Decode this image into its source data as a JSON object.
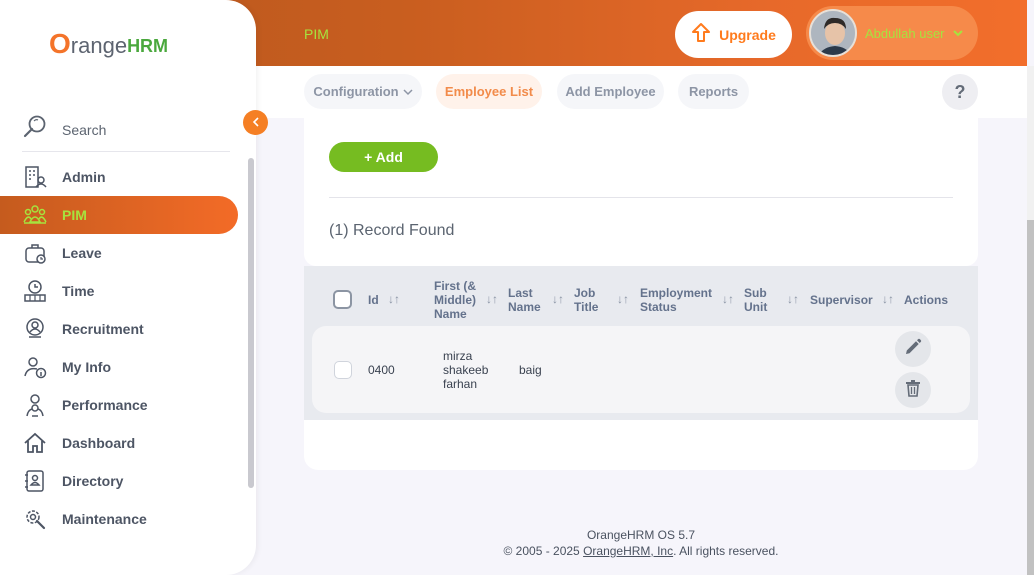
{
  "header": {
    "module_title": "PIM",
    "upgrade_label": "Upgrade",
    "user_name": "Abdullah user"
  },
  "subnav": {
    "items": [
      {
        "label": "Configuration"
      },
      {
        "label": "Employee List"
      },
      {
        "label": "Add Employee"
      },
      {
        "label": "Reports"
      }
    ],
    "active": "Employee List",
    "help_label": "?"
  },
  "sidebar": {
    "logo": {
      "o": "O",
      "range": "range",
      "hrm": "HRM"
    },
    "search_label": "Search",
    "items": [
      {
        "label": "Admin",
        "icon": "admin-icon"
      },
      {
        "label": "PIM",
        "icon": "pim-icon"
      },
      {
        "label": "Leave",
        "icon": "leave-icon"
      },
      {
        "label": "Time",
        "icon": "time-icon"
      },
      {
        "label": "Recruitment",
        "icon": "recruitment-icon"
      },
      {
        "label": "My Info",
        "icon": "my-info-icon"
      },
      {
        "label": "Performance",
        "icon": "performance-icon"
      },
      {
        "label": "Dashboard",
        "icon": "dashboard-icon"
      },
      {
        "label": "Directory",
        "icon": "directory-icon"
      },
      {
        "label": "Maintenance",
        "icon": "maintenance-icon"
      }
    ],
    "active": "PIM"
  },
  "main": {
    "add_label": "+ Add",
    "records_text": "(1) Record Found",
    "table": {
      "columns": [
        "Id",
        "First (& Middle) Name",
        "Last Name",
        "Job Title",
        "Employment Status",
        "Sub Unit",
        "Supervisor",
        "Actions"
      ],
      "rows": [
        {
          "id": "0400",
          "first_middle": [
            "mirza",
            "shakeeb",
            "farhan"
          ],
          "last": "baig",
          "job_title": "",
          "employment_status": "",
          "sub_unit": "",
          "supervisor": ""
        }
      ]
    }
  },
  "footer": {
    "version": "OrangeHRM OS 5.7",
    "copyright_prefix": "© 2005 - 2025 ",
    "company_link": "OrangeHRM, Inc",
    "copyright_suffix": ". All rights reserved."
  },
  "colors": {
    "accent_orange": "#f36b27",
    "accent_green": "#76bc21",
    "active_text_green": "#a6e33e"
  }
}
